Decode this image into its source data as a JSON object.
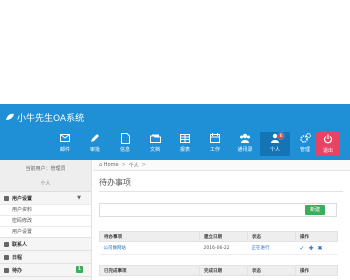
{
  "app": {
    "title": "小牛先生OA系统"
  },
  "nav": [
    {
      "label": "邮件",
      "icon": "mail-icon"
    },
    {
      "label": "审批",
      "icon": "pencil-icon"
    },
    {
      "label": "信息",
      "icon": "document-icon"
    },
    {
      "label": "文档",
      "icon": "folder-icon"
    },
    {
      "label": "报表",
      "icon": "table-icon"
    },
    {
      "label": "工作",
      "icon": "calendar-icon"
    },
    {
      "label": "通讯录",
      "icon": "contacts-icon"
    },
    {
      "label": "个人",
      "icon": "person-icon",
      "badge": "6"
    },
    {
      "label": "管理",
      "icon": "gears-icon"
    }
  ],
  "logout": {
    "label": "退出"
  },
  "sidebar": {
    "user_line": "当前用户：管理员",
    "current_module": "个人",
    "sections": [
      {
        "label": "用户设置",
        "items": [
          "用户资料",
          "密码修改",
          "用户设置"
        ]
      },
      {
        "label": "联系人"
      },
      {
        "label": "日程"
      },
      {
        "label": "待办",
        "badge": "1"
      }
    ]
  },
  "breadcrumb": {
    "home": "Home",
    "current": "个人"
  },
  "content": {
    "title": "待办事项",
    "new_button": "新建",
    "todo_table": {
      "headers": [
        "待办事项",
        "建立日期",
        "状态",
        "操作"
      ],
      "rows": [
        {
          "item": "公司做网站",
          "date": "2016-06-22",
          "status": "正在进行"
        }
      ]
    },
    "done_table": {
      "headers": [
        "已完成事项",
        "完成日期",
        "状态",
        "操作"
      ]
    }
  },
  "colors": {
    "primary": "#1f8fd6",
    "logout": "#e84362",
    "success": "#3aaf5a",
    "badge": "#e74c3c"
  }
}
